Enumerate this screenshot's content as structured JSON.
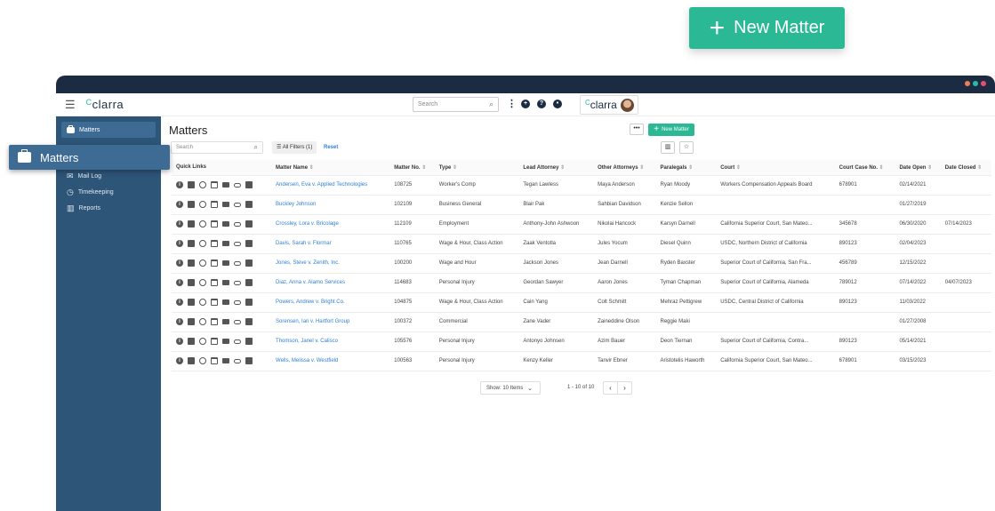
{
  "callout": {
    "new_matter_label": "New Matter",
    "popout_label": "Matters"
  },
  "window": {
    "dot_colors": [
      "#f07c52",
      "#2bb8a5",
      "#e84f6f"
    ]
  },
  "topbar": {
    "logo": "clarra",
    "search_placeholder": "Search",
    "brand": "clarra"
  },
  "sidebar": {
    "active": "Matters",
    "items": [
      {
        "label": "Mail Log",
        "icon": "mail-icon"
      },
      {
        "label": "Timekeeping",
        "icon": "clock-icon"
      },
      {
        "label": "Reports",
        "icon": "report-icon"
      }
    ]
  },
  "main": {
    "title": "Matters",
    "more_label": "•••",
    "new_matter_label": "New Matter",
    "search_placeholder": "Search",
    "filters_label": "All Filters (1)",
    "reset_label": "Reset"
  },
  "table": {
    "columns": [
      "Quick Links",
      "Matter Name",
      "Matter No.",
      "Type",
      "Lead Attorney",
      "Other Attorneys",
      "Paralegals",
      "Court",
      "Court Case No.",
      "Date Open",
      "Date Closed"
    ],
    "rows": [
      [
        "Andersen, Eva v. Applied Technologies",
        "108725",
        "Worker's Comp",
        "Tegan Lawless",
        "Maya Anderson",
        "Ryan Moody",
        "Workers Compensation Appeals Board",
        "678901",
        "02/14/2021",
        ""
      ],
      [
        "Buckley Johnson",
        "102109",
        "Business General",
        "Blair Pak",
        "Sahbian Davidson",
        "Kenzie Sellon",
        "",
        "",
        "01/27/2019",
        ""
      ],
      [
        "Crossley, Lora v. Bricolage",
        "112109",
        "Employment",
        "Anthony-John Ashwoon",
        "Nikolai Hancock",
        "Karsyn Darnell",
        "California Superior Court, San Mateo...",
        "345678",
        "06/30/2020",
        "07/14/2023"
      ],
      [
        "Davis, Sarah v. Flormar",
        "110765",
        "Wage & Hour, Class Action",
        "Zaak Ventotla",
        "Jules Yocum",
        "Diesel Quinn",
        "USDC, Northern District of California",
        "890123",
        "02/04/2023",
        ""
      ],
      [
        "Jones, Steve v. Zenith, Inc.",
        "100200",
        "Wage and Hour",
        "Jackson Jones",
        "Jean Darnell",
        "Ryden Baxster",
        "Superior Court of California, San Fra...",
        "456789",
        "12/15/2022",
        ""
      ],
      [
        "Diaz, Anna v. Alamo Services",
        "114683",
        "Personal Injury",
        "Geordan Sawyer",
        "Aaron Jones",
        "Tyman Chapman",
        "Superior Court of California, Alameda",
        "789012",
        "07/14/2022",
        "04/07/2023"
      ],
      [
        "Powers, Andrew v. Bright Co.",
        "104875",
        "Wage & Hour, Class Action",
        "Cain Yang",
        "Colt Schmitt",
        "Mehraz Pettigrew",
        "USDC, Central District of California",
        "890123",
        "11/03/2022",
        ""
      ],
      [
        "Sorensen, Ian v. Hartfort Group",
        "100372",
        "Commercial",
        "Zane Vader",
        "Zaineddine Olson",
        "Reggie Maki",
        "",
        "",
        "01/27/2008",
        ""
      ],
      [
        "Thomson, Janel v. Calisco",
        "105576",
        "Personal Injury",
        "Antonyo Johnsen",
        "Azim Bauer",
        "Deon Tiernan",
        "Superior Court of California, Contra...",
        "890123",
        "05/14/2021",
        ""
      ],
      [
        "Wells, Melissa v. Westfield",
        "100563",
        "Personal Injury",
        "Kenzy Keller",
        "Tanvir Ebner",
        "Aristotelis Haworth",
        "California Superior Court, San Mateo...",
        "678901",
        "03/15/2023",
        ""
      ]
    ]
  },
  "pager": {
    "show_label": "Show: 10 Items",
    "range": "1 - 10 of 10"
  }
}
